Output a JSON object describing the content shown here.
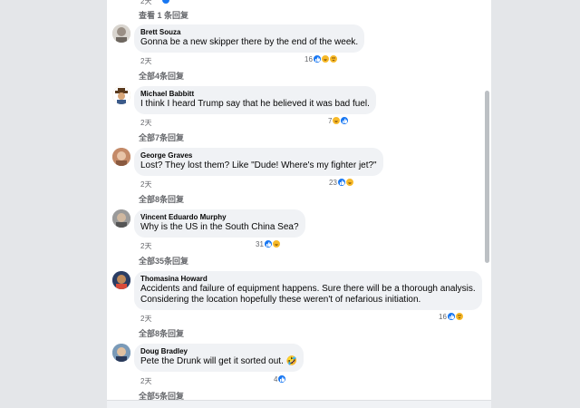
{
  "top_partial": {
    "meta": "2天",
    "replies": "查看 1 条回复"
  },
  "comments": [
    {
      "author": "Brett Souza",
      "lines": [
        "Gonna be a new skipper there by the end of the week."
      ],
      "time": "2天",
      "reaction_count": "16",
      "reactions": [
        "like-icon",
        "haha-icon",
        "sad-icon"
      ],
      "replies": "全部4条回复"
    },
    {
      "author": "Michael Babbitt",
      "lines": [
        "I think I heard Trump say that he believed it was bad fuel."
      ],
      "time": "2天",
      "reaction_count": "7",
      "reactions": [
        "haha-icon",
        "like-icon"
      ],
      "replies": "全部7条回复"
    },
    {
      "author": "George Graves",
      "lines": [
        "Lost? They lost them? Like \"Dude! Where's my fighter jet?\""
      ],
      "time": "2天",
      "reaction_count": "23",
      "reactions": [
        "like-icon",
        "haha-icon"
      ],
      "replies": "全部8条回复"
    },
    {
      "author": "Vincent Eduardo Murphy",
      "lines": [
        "Why is the US in the South China Sea?"
      ],
      "time": "2天",
      "reaction_count": "31",
      "reactions": [
        "like-icon",
        "haha-icon"
      ],
      "replies": "全部35条回复"
    },
    {
      "author": "Thomasina Howard",
      "lines": [
        "Accidents and failure of equipment happens. Sure there will be a thorough analysis.",
        "Considering the location hopefully these weren't of nefarious initiation."
      ],
      "time": "2天",
      "reaction_count": "16",
      "reactions": [
        "like-icon",
        "sad-icon"
      ],
      "replies": "全部8条回复"
    },
    {
      "author": "Doug Bradley",
      "lines": [
        "Pete the Drunk will get it sorted out. 🤣"
      ],
      "time": "2天",
      "reaction_count": "4",
      "reactions": [
        "like-icon"
      ],
      "replies": "全部5条回复"
    }
  ],
  "colors": {
    "page_bg": "#e4e6e9",
    "bubble_bg": "#f0f2f5",
    "like_blue": "#1877f2",
    "emoji_yellow": "#f7b928",
    "meta_gray": "#65676b"
  }
}
